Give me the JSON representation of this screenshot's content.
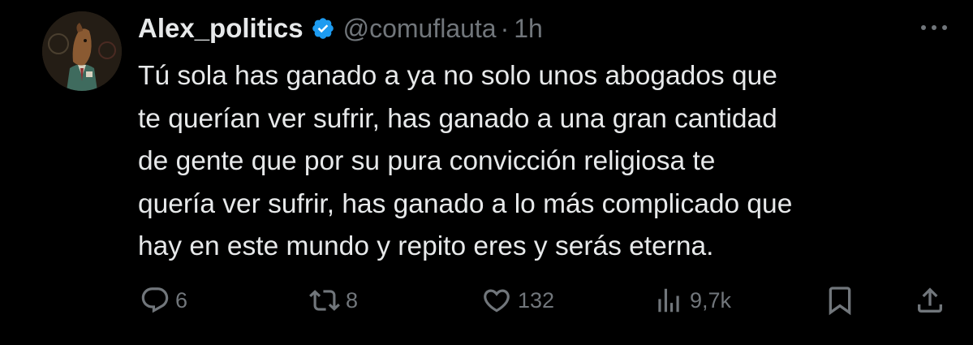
{
  "user": {
    "name": "Alex_politics",
    "handle": "@comuflauta",
    "separator": "·",
    "time": "1h",
    "verified": true
  },
  "tweet": {
    "text_lines": [
      "Tú sola has ganado a ya no solo unos abogados que",
      "te querían ver sufrir, has ganado a una gran cantidad",
      "de gente que por su pura convicción religiosa te",
      "quería ver sufrir, has ganado a lo más complicado que",
      "hay en este mundo y repito eres y serás eterna."
    ]
  },
  "actions": {
    "replies": "6",
    "retweets": "8",
    "likes": "132",
    "views": "9,7k"
  },
  "colors": {
    "background": "#000000",
    "text": "#e7e9ea",
    "muted": "#71767b",
    "verified": "#1d9bf0"
  },
  "icons": [
    "more-icon",
    "reply-icon",
    "retweet-icon",
    "like-icon",
    "views-icon",
    "bookmark-icon",
    "share-icon",
    "verified-badge-icon"
  ]
}
